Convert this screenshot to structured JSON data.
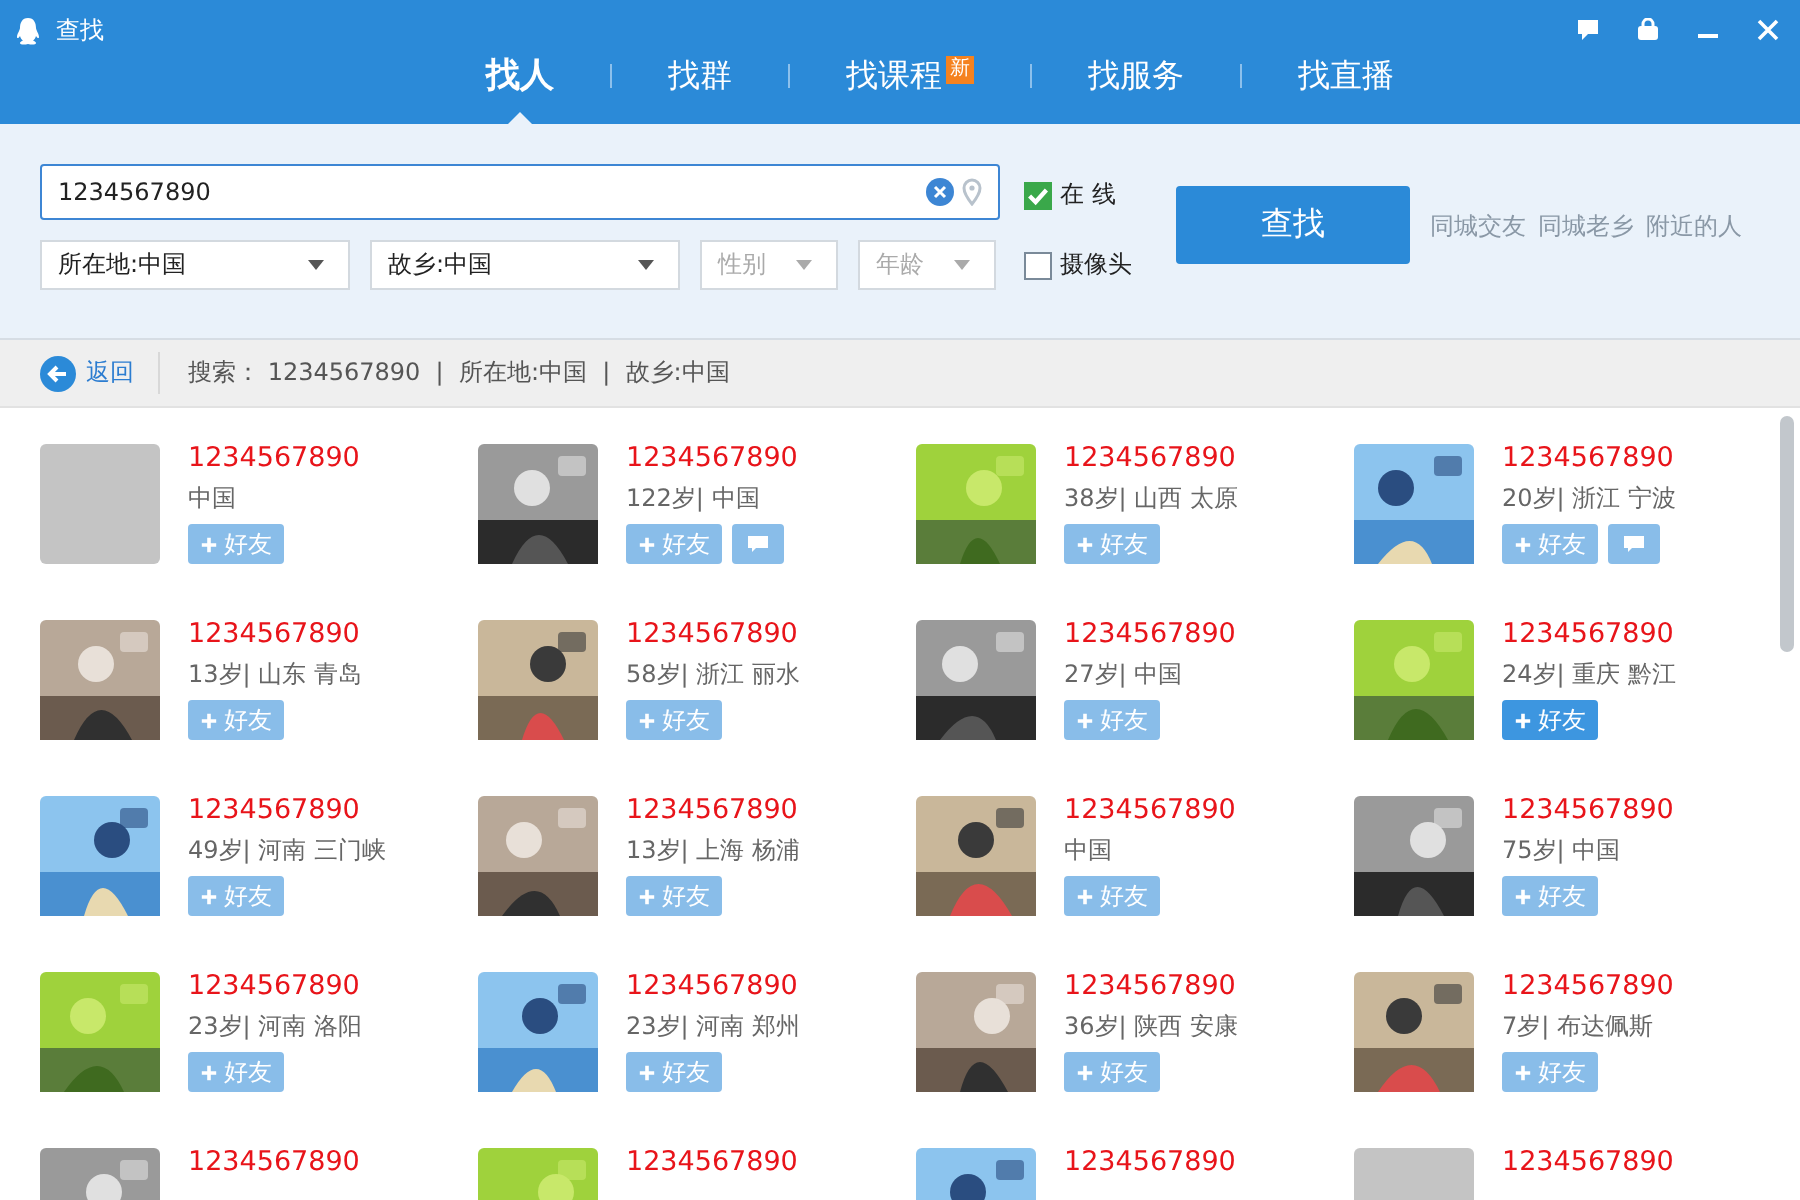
{
  "window": {
    "title": "查找"
  },
  "tabs": [
    {
      "label": "找人",
      "selected": true
    },
    {
      "label": "找群",
      "selected": false
    },
    {
      "label": "找课程",
      "selected": false,
      "badge": "新"
    },
    {
      "label": "找服务",
      "selected": false
    },
    {
      "label": "找直播",
      "selected": false
    }
  ],
  "search": {
    "value": "1234567890",
    "online": {
      "label": "在  线",
      "checked": true
    },
    "camera": {
      "label": "摄像头",
      "checked": false
    },
    "filters": [
      {
        "label": "所在地:中国",
        "muted": false
      },
      {
        "label": "故乡:中国",
        "muted": false
      },
      {
        "label": "性别",
        "muted": true
      },
      {
        "label": "年龄",
        "muted": true
      }
    ],
    "button": "查找",
    "links": [
      "同城交友",
      "同城老乡",
      "附近的人"
    ]
  },
  "breadcrumb": {
    "back": "返回",
    "text": "搜索： 1234567890  |  所在地:中国  |  故乡:中国"
  },
  "results": [
    {
      "name": "1234567890",
      "info": "中国",
      "add": "好友",
      "highlighted": false,
      "message": false,
      "photo": false
    },
    {
      "name": "1234567890",
      "info": "122岁| 中国",
      "add": "好友",
      "highlighted": false,
      "message": true,
      "photo": true
    },
    {
      "name": "1234567890",
      "info": "38岁| 山西 太原",
      "add": "好友",
      "highlighted": false,
      "message": false,
      "photo": true
    },
    {
      "name": "1234567890",
      "info": "20岁| 浙江 宁波",
      "add": "好友",
      "highlighted": false,
      "message": true,
      "photo": true
    },
    {
      "name": "1234567890",
      "info": "13岁| 山东 青岛",
      "add": "好友",
      "highlighted": false,
      "message": false,
      "photo": true
    },
    {
      "name": "1234567890",
      "info": "58岁| 浙江 丽水",
      "add": "好友",
      "highlighted": false,
      "message": false,
      "photo": true
    },
    {
      "name": "1234567890",
      "info": "27岁| 中国",
      "add": "好友",
      "highlighted": false,
      "message": false,
      "photo": true
    },
    {
      "name": "1234567890",
      "info": "24岁| 重庆 黔江",
      "add": "好友",
      "highlighted": true,
      "message": false,
      "photo": true
    },
    {
      "name": "1234567890",
      "info": "49岁| 河南 三门峡",
      "add": "好友",
      "highlighted": false,
      "message": false,
      "photo": true
    },
    {
      "name": "1234567890",
      "info": "13岁| 上海 杨浦",
      "add": "好友",
      "highlighted": false,
      "message": false,
      "photo": true
    },
    {
      "name": "1234567890",
      "info": "中国",
      "add": "好友",
      "highlighted": false,
      "message": false,
      "photo": true
    },
    {
      "name": "1234567890",
      "info": "75岁| 中国",
      "add": "好友",
      "highlighted": false,
      "message": false,
      "photo": true
    },
    {
      "name": "1234567890",
      "info": "23岁| 河南 洛阳",
      "add": "好友",
      "highlighted": false,
      "message": false,
      "photo": true
    },
    {
      "name": "1234567890",
      "info": "23岁| 河南 郑州",
      "add": "好友",
      "highlighted": false,
      "message": false,
      "photo": true
    },
    {
      "name": "1234567890",
      "info": "36岁| 陕西 安康",
      "add": "好友",
      "highlighted": false,
      "message": false,
      "photo": true
    },
    {
      "name": "1234567890",
      "info": "7岁| 布达佩斯",
      "add": "好友",
      "highlighted": false,
      "message": false,
      "photo": true
    },
    {
      "name": "1234567890",
      "photo": true
    },
    {
      "name": "1234567890",
      "photo": true
    },
    {
      "name": "1234567890",
      "photo": true
    },
    {
      "name": "1234567890",
      "photo": false
    }
  ]
}
